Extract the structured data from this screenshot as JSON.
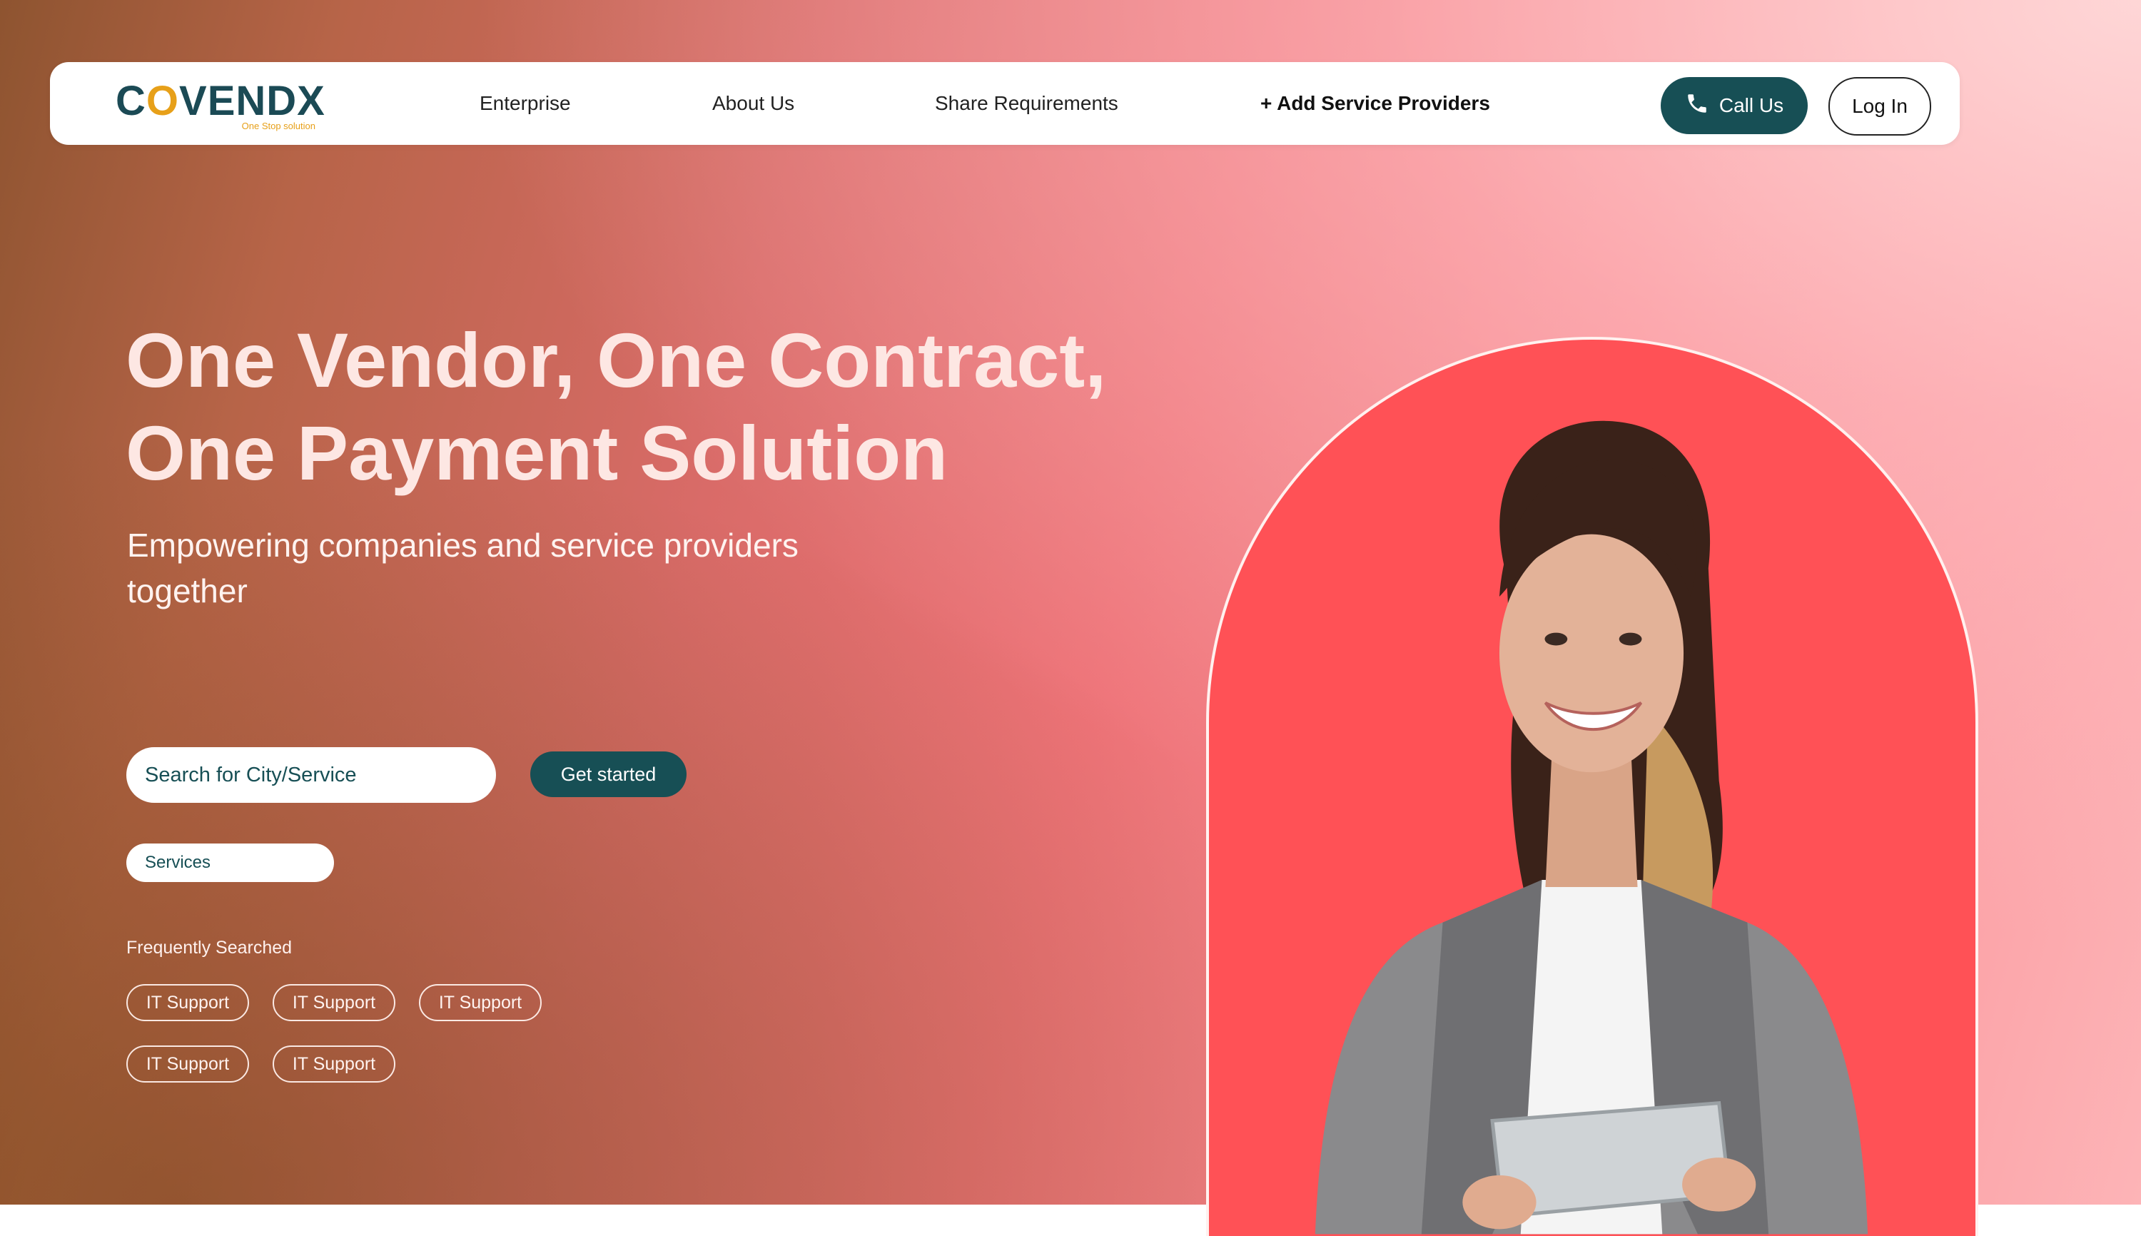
{
  "nav": {
    "logo_text_pre": "C",
    "logo_text_accent": "O",
    "logo_text_post": "VENDX",
    "logo_tagline": "One Stop solution",
    "links": [
      "Enterprise",
      "About Us",
      "Share Requirements",
      "+ Add Service Providers"
    ],
    "call_label": "Call Us",
    "call_icon": "phone-icon",
    "login_label": "Log In"
  },
  "hero": {
    "title_line1": "One Vendor, One Contract,",
    "title_line2": "One Payment Solution",
    "subtitle_line1": "Empowering companies and service providers",
    "subtitle_line2": "together"
  },
  "search": {
    "placeholder": "Search for City/Service",
    "button_label": "Get started",
    "services_value": "Services"
  },
  "frequent": {
    "label": "Frequently Searched",
    "chips": [
      "IT Support",
      "IT Support",
      "IT Support",
      "IT Support",
      "IT Support"
    ]
  },
  "colors": {
    "brand_teal": "#174f55",
    "brand_gold": "#e7a019",
    "arch_red": "#ff5156"
  }
}
